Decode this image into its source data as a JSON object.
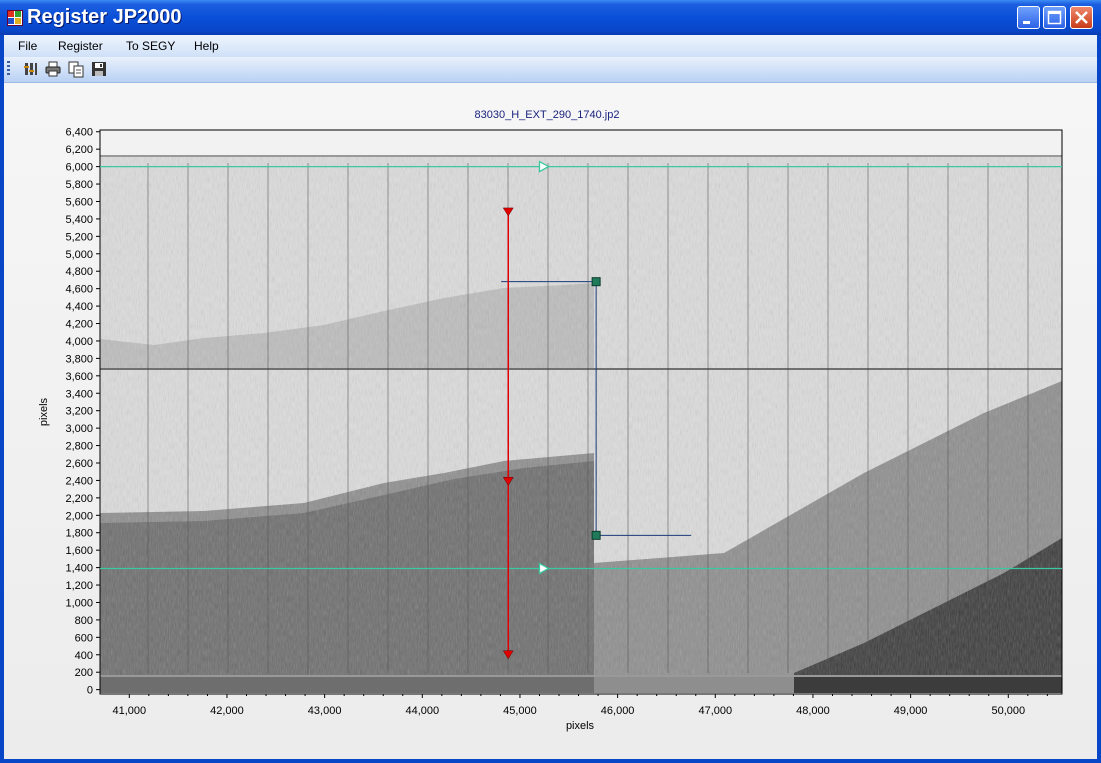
{
  "window": {
    "title": "Register JP2000"
  },
  "menu": {
    "file": "File",
    "register": "Register",
    "to_segy": "To SEGY",
    "help": "Help"
  },
  "toolbar": {
    "icons": [
      "properties-icon",
      "print-icon",
      "copy-icon",
      "save-icon"
    ]
  },
  "plot": {
    "title": "83030_H_EXT_290_1740.jp2",
    "xlabel": "pixels",
    "ylabel": "pixels",
    "xticks": [
      "41,000",
      "42,000",
      "43,000",
      "44,000",
      "45,000",
      "46,000",
      "47,000",
      "48,000",
      "49,000",
      "50,000"
    ],
    "yticks": [
      "0",
      "200",
      "400",
      "600",
      "800",
      "1,000",
      "1,200",
      "1,400",
      "1,600",
      "1,800",
      "2,000",
      "2,200",
      "2,400",
      "2,600",
      "2,800",
      "3,000",
      "3,200",
      "3,400",
      "3,600",
      "3,800",
      "4,000",
      "4,200",
      "4,400",
      "4,600",
      "4,800",
      "5,000",
      "5,200",
      "5,400",
      "5,600",
      "5,800",
      "6,000",
      "6,200",
      "6,400"
    ],
    "xlim": [
      40700,
      50550
    ],
    "ylim": [
      -50,
      6420
    ],
    "registration": {
      "red_line": {
        "x": 44880,
        "y_top": 5480,
        "y_mid": 2390,
        "y_bottom": 400
      },
      "green_lines": {
        "top_y": 6000,
        "bottom_y": 1390,
        "marker_x": 45200
      },
      "blue_bracket": {
        "x": 45780,
        "y_top": 4680,
        "y_bottom": 1770
      }
    },
    "colors": {
      "red": "#e00000",
      "green": "#3cc8a0",
      "blue": "#1a3a7a"
    }
  }
}
